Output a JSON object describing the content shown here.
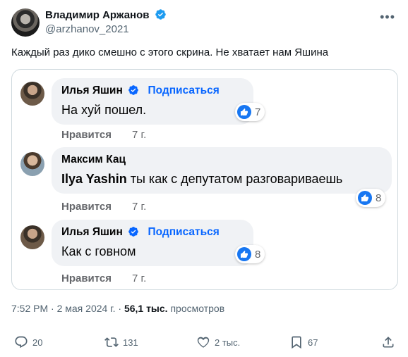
{
  "tweet": {
    "author_name": "Владимир Аржанов",
    "handle": "@arzhanov_2021",
    "more_icon": "•••",
    "text": "Каждый раз дико смешно с этого скрина. Не хватает нам Яшина"
  },
  "colors": {
    "verified": "#1d9bf0",
    "fb_blue": "#1877f2",
    "link": "#0866ff"
  },
  "screenshot": {
    "comments": [
      {
        "author": "Илья Яшин",
        "subscribe": "Подписаться",
        "text": "На хуй пошел.",
        "reactions": "7",
        "like": "Нравится",
        "time": "7 г."
      },
      {
        "author": "Максим Кац",
        "mention": "Ilya Yashin",
        "text": " ты как с депутатом разговариваешь",
        "reactions": "8",
        "like": "Нравится",
        "time": "7 г."
      },
      {
        "author": "Илья Яшин",
        "subscribe": "Подписаться",
        "text": "Как с говном",
        "reactions": "8",
        "like": "Нравится",
        "time": "7 г."
      }
    ]
  },
  "meta": {
    "time": "7:52 PM",
    "separator": " · ",
    "date": "2 мая 2024 г.",
    "views_count": "56,1 тыс.",
    "views_label": " просмотров"
  },
  "actions": {
    "replies": "20",
    "reposts": "131",
    "likes": "2 тыс.",
    "bookmarks": "67"
  }
}
